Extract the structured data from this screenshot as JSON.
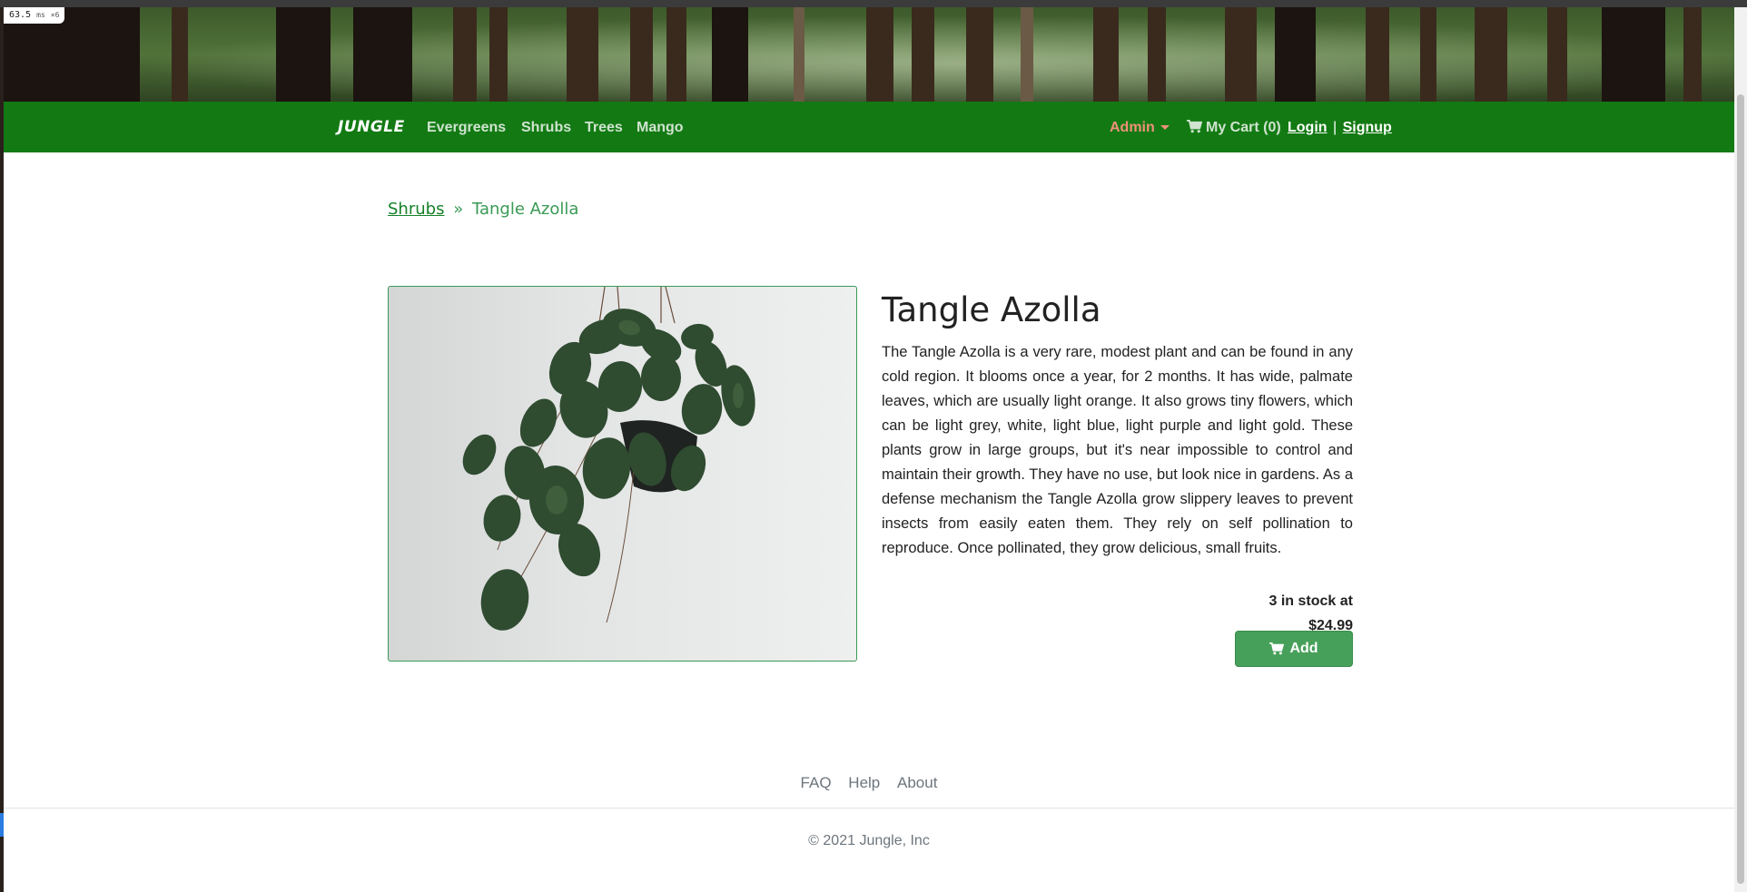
{
  "perf": {
    "ms": "63.5",
    "unit": "ms",
    "count": "×6"
  },
  "nav": {
    "brand": "JUNGLE",
    "links": [
      "Evergreens",
      "Shrubs",
      "Trees",
      "Mango"
    ],
    "admin_label": "Admin",
    "cart_label": "My Cart (0)",
    "login": "Login",
    "separator": "|",
    "signup": "Signup"
  },
  "breadcrumb": {
    "parent": "Shrubs",
    "separator": "»",
    "current": "Tangle Azolla"
  },
  "product": {
    "image_icon": "hanging-plant-photo",
    "title": "Tangle Azolla",
    "description": "The Tangle Azolla is a very rare, modest plant and can be found in any cold region. It blooms once a year, for 2 months. It has wide, palmate leaves, which are usually light orange. It also grows tiny flowers, which can be light grey, white, light blue, light purple and light gold. These plants grow in large groups, but it's near impossible to control and maintain their growth. They have no use, but look nice in gardens. As a defense mechanism the Tangle Azolla grow slippery leaves to prevent insects from easily eaten them. They rely on self pollination to reproduce. Once pollinated, they grow delicious, small fruits.",
    "stock_line": "3 in stock at",
    "price": "$24.99",
    "add_label": "Add"
  },
  "footer": {
    "links": [
      "FAQ",
      "Help",
      "About"
    ],
    "copyright": "© 2021 Jungle, Inc"
  },
  "colors": {
    "navbar": "#137a13",
    "add_button": "#47a05a",
    "admin": "#f0907a",
    "breadcrumb": "#3a9a55"
  }
}
